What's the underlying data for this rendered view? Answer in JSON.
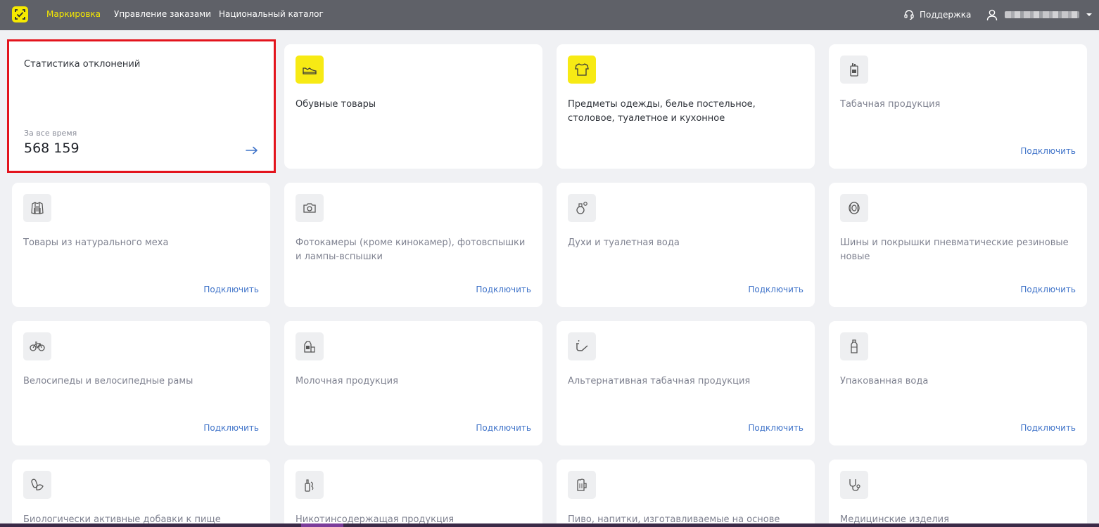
{
  "header": {
    "nav": [
      {
        "label": "Маркировка"
      },
      {
        "label": "Управление заказами"
      },
      {
        "label": "Национальный каталог"
      }
    ],
    "support_label": "Поддержка",
    "colors": {
      "bar": "#5f6168",
      "accent": "#f6e900"
    }
  },
  "stats": {
    "title": "Статистика отклонений",
    "period": "За все время",
    "value": "568 159"
  },
  "cards": [
    {
      "title": "Обувные товары",
      "icon": "shoe-icon",
      "connect": ""
    },
    {
      "title": "Предметы одежды, белье постельное, столовое, туалетное и кухонное",
      "icon": "tshirt-icon",
      "connect": ""
    },
    {
      "title": "Табачная продукция",
      "icon": "cigarette-pack-icon",
      "connect": "Подключить"
    },
    {
      "title": "Товары из натурального меха",
      "icon": "fur-coat-icon",
      "connect": "Подключить"
    },
    {
      "title": "Фотокамеры (кроме кинокамер), фотовспышки и лампы-вспышки",
      "icon": "camera-icon",
      "connect": "Подключить"
    },
    {
      "title": "Духи и туалетная вода",
      "icon": "perfume-icon",
      "connect": "Подключить"
    },
    {
      "title": "Шины и покрышки пневматические резиновые новые",
      "icon": "tire-icon",
      "connect": "Подключить"
    },
    {
      "title": "Велосипеды и велосипедные рамы",
      "icon": "bicycle-icon",
      "connect": "Подключить"
    },
    {
      "title": "Молочная продукция",
      "icon": "milk-icon",
      "connect": "Подключить"
    },
    {
      "title": "Альтернативная табачная продукция",
      "icon": "pipe-icon",
      "connect": "Подключить"
    },
    {
      "title": "Упакованная вода",
      "icon": "water-bottle-icon",
      "connect": "Подключить"
    },
    {
      "title": "Биологически активные добавки к пище",
      "icon": "supplements-icon",
      "connect": ""
    },
    {
      "title": "Никотинсодержащая продукция",
      "icon": "vape-icon",
      "connect": ""
    },
    {
      "title": "Пиво, напитки, изготавливаемые на основе пива, и",
      "icon": "beer-icon",
      "connect": ""
    },
    {
      "title": "Медицинские изделия",
      "icon": "stethoscope-icon",
      "connect": ""
    }
  ]
}
